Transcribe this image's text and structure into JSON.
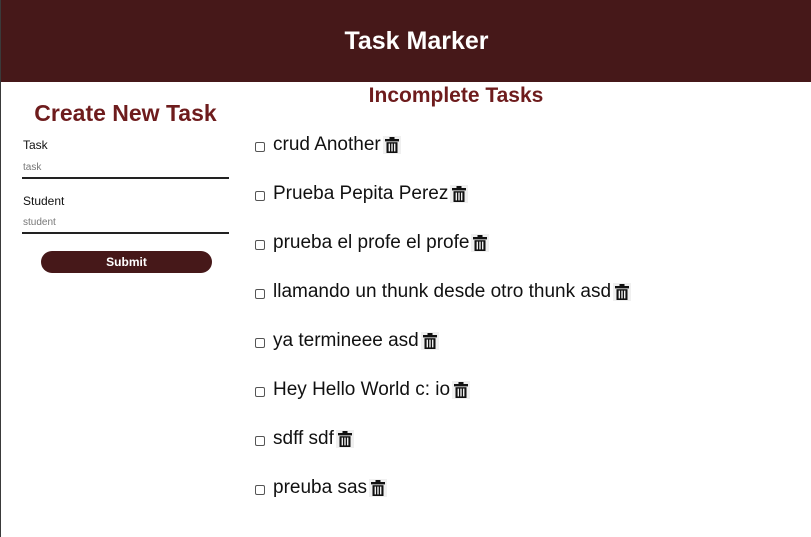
{
  "header": {
    "title": "Task Marker"
  },
  "create_form": {
    "title": "Create New Task",
    "task_label": "Task",
    "task_placeholder": "task",
    "student_label": "Student",
    "student_placeholder": "student",
    "submit_label": "Submit"
  },
  "tasks_section": {
    "title": "Incomplete Tasks",
    "items": [
      {
        "text": "crud  Another"
      },
      {
        "text": "Prueba  Pepita Perez"
      },
      {
        "text": "prueba el profe  el profe"
      },
      {
        "text": "llamando un thunk desde otro thunk  asd"
      },
      {
        "text": "ya termineee  asd"
      },
      {
        "text": "Hey Hello World c:  io"
      },
      {
        "text": "sdff  sdf"
      },
      {
        "text": "preuba  sas"
      }
    ],
    "delete_icon": "trash-icon"
  },
  "colors": {
    "header_bg": "#461819",
    "accent_title": "#6e1c1d",
    "button_bg": "#461819"
  }
}
